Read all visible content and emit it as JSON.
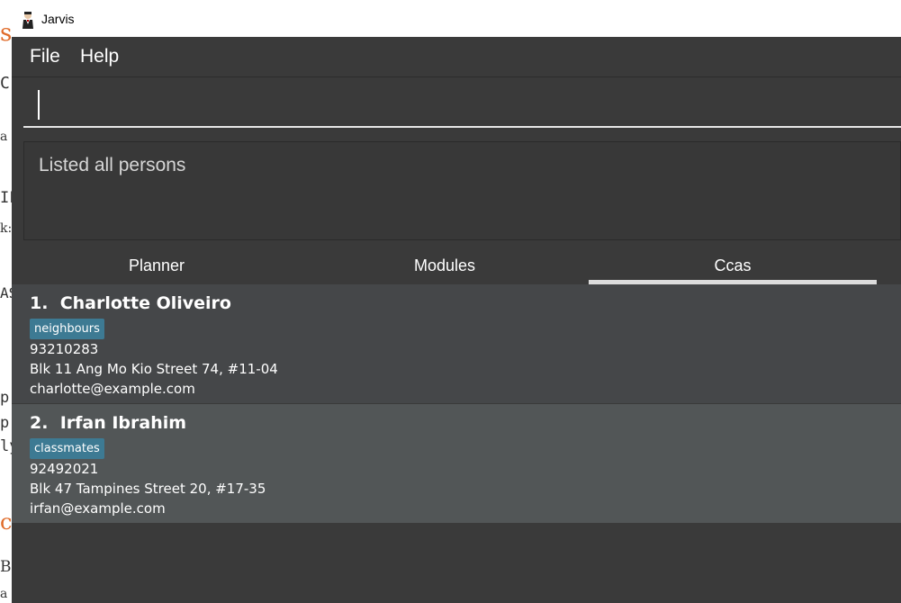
{
  "window": {
    "title": "Jarvis"
  },
  "menu": {
    "items": [
      "File",
      "Help"
    ]
  },
  "command": {
    "value": ""
  },
  "result": {
    "text": "Listed all persons"
  },
  "tabs": [
    {
      "label": "Planner",
      "selected": false
    },
    {
      "label": "Modules",
      "selected": false
    },
    {
      "label": "Ccas",
      "selected": true
    }
  ],
  "persons": [
    {
      "index": "1.",
      "name": "Charlotte Oliveiro",
      "tag": "neighbours",
      "phone": "93210283",
      "address": "Blk 11 Ang Mo Kio Street 74, #11-04",
      "email": "charlotte@example.com"
    },
    {
      "index": "2.",
      "name": "Irfan Ibrahim",
      "tag": "classmates",
      "phone": "92492021",
      "address": "Blk 47 Tampines Street 20, #17-35",
      "email": "irfan@example.com"
    }
  ],
  "colors": {
    "window_bg": "#3a3a3a",
    "card_bg": "#454749",
    "card_bg_selected": "#525657",
    "tag_bg": "#3d7a93",
    "background_heading": "#e06c2b"
  }
}
